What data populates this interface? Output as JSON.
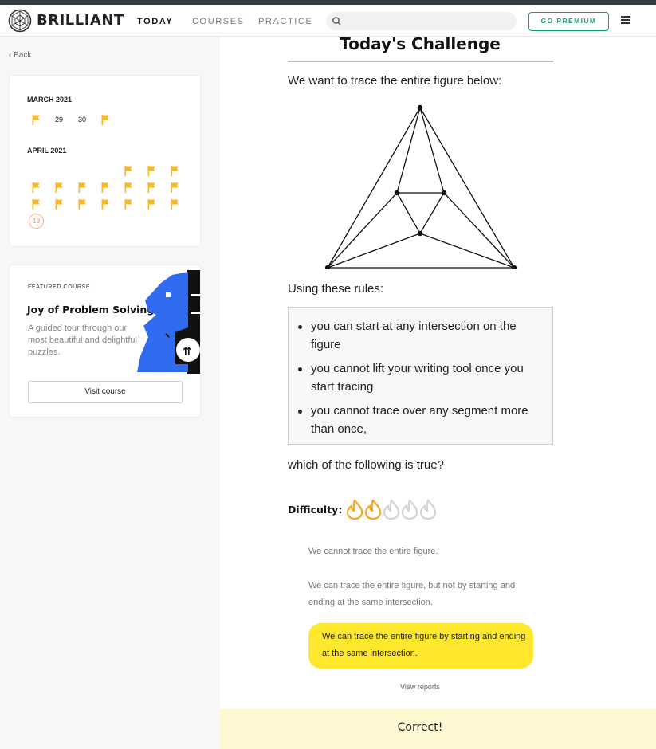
{
  "header": {
    "brand": "BRILLIANT",
    "nav": [
      {
        "label": "TODAY",
        "active": true
      },
      {
        "label": "COURSES",
        "active": false
      },
      {
        "label": "PRACTICE",
        "active": false
      }
    ],
    "search_placeholder": "",
    "premium_label": "GO PREMIUM",
    "icons": {
      "logo": "brilliant-logo-icon",
      "search": "search-icon",
      "menu": "hamburger-menu-icon"
    }
  },
  "sidebar": {
    "back_label": "Back",
    "calendar": {
      "months": [
        {
          "name": "MARCH 2021",
          "days": [
            {
              "flag": true
            },
            {
              "label": "29"
            },
            {
              "label": "30"
            },
            {
              "flag": true
            }
          ]
        },
        {
          "name": "APRIL 2021",
          "flag_count": 17,
          "today": "19"
        }
      ],
      "flag_color": "#f8b724"
    },
    "featured": {
      "label": "FEATURED COURSE",
      "title": "Joy of Problem Solving",
      "description": "A guided tour through our most beautiful and delightful puzzles.",
      "button": "Visit course",
      "art": "chess-knight-illustration"
    }
  },
  "main": {
    "title": "Today's Challenge",
    "intro": "We want to trace the entire figure below:",
    "rules_intro": "Using these rules:",
    "rules": [
      "you can start at any intersection on the figure",
      "you cannot lift your writing tool once you start tracing",
      "you cannot trace over any segment more than once,"
    ],
    "question": "which of the following is true?",
    "difficulty_label": "Difficulty:",
    "difficulty_level": 2,
    "difficulty_max": 5,
    "options": [
      {
        "text": "We cannot trace the entire figure.",
        "selected": false
      },
      {
        "text": "We can trace the entire figure, but not by starting and ending at the same intersection.",
        "selected": false
      },
      {
        "text": "We can trace the entire figure by starting and ending at the same intersection.",
        "selected": true
      }
    ],
    "view_reports": "View reports",
    "result": "Correct!"
  },
  "colors": {
    "premium": "#18a078",
    "selected_option": "#ffe72e",
    "flame_active": "#f5a623",
    "flame_inactive": "#d4d4d4",
    "result_bg": "#fdf7d2"
  }
}
